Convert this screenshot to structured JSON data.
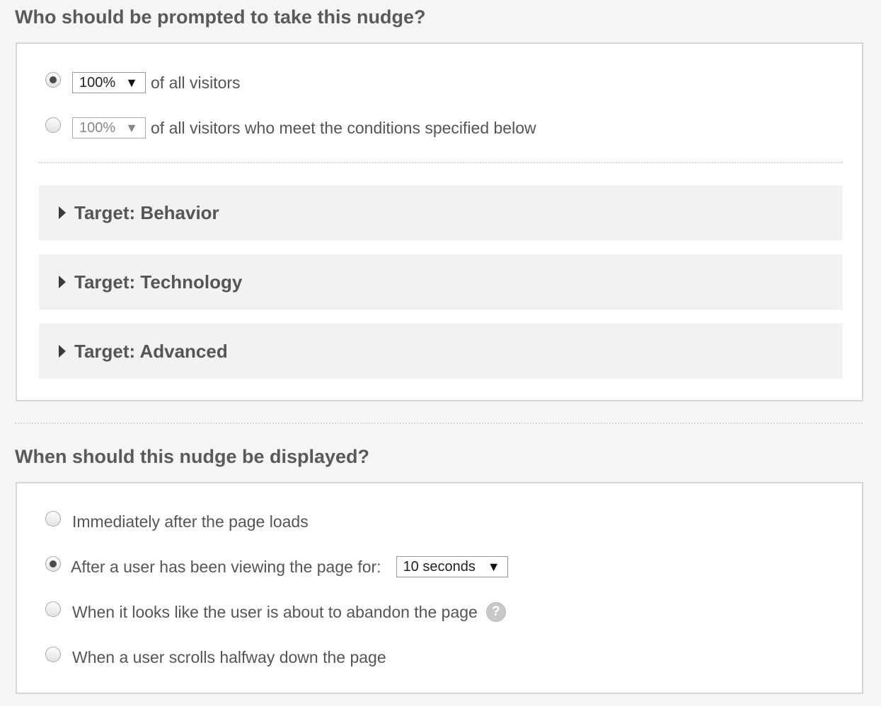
{
  "who_section": {
    "title": "Who should be prompted to take this nudge?",
    "option_all": {
      "selected": true,
      "percent_value": "100%",
      "label": "of all visitors"
    },
    "option_conditional": {
      "selected": false,
      "percent_value": "100%",
      "label": "of all visitors who meet the conditions specified below"
    },
    "targets": [
      {
        "label": "Target: Behavior",
        "expanded": false
      },
      {
        "label": "Target: Technology",
        "expanded": false
      },
      {
        "label": "Target: Advanced",
        "expanded": false
      }
    ]
  },
  "when_section": {
    "title": "When should this nudge be displayed?",
    "options": [
      {
        "label": "Immediately after the page loads",
        "selected": false
      },
      {
        "label": "After a user has been viewing the page for:",
        "selected": true,
        "duration_value": "10 seconds"
      },
      {
        "label": "When it looks like the user is about to abandon the page",
        "selected": false,
        "help_icon": "?"
      },
      {
        "label": "When a user scrolls halfway down the page",
        "selected": false
      }
    ]
  },
  "icons": {
    "dropdown_arrow": "▼",
    "caret": "caret-right-icon",
    "help": "question-circle-icon"
  },
  "colors": {
    "background": "#f5f5f5",
    "panel_bg": "#ffffff",
    "accordion_bg": "#f2f2f2",
    "text": "#555555"
  }
}
